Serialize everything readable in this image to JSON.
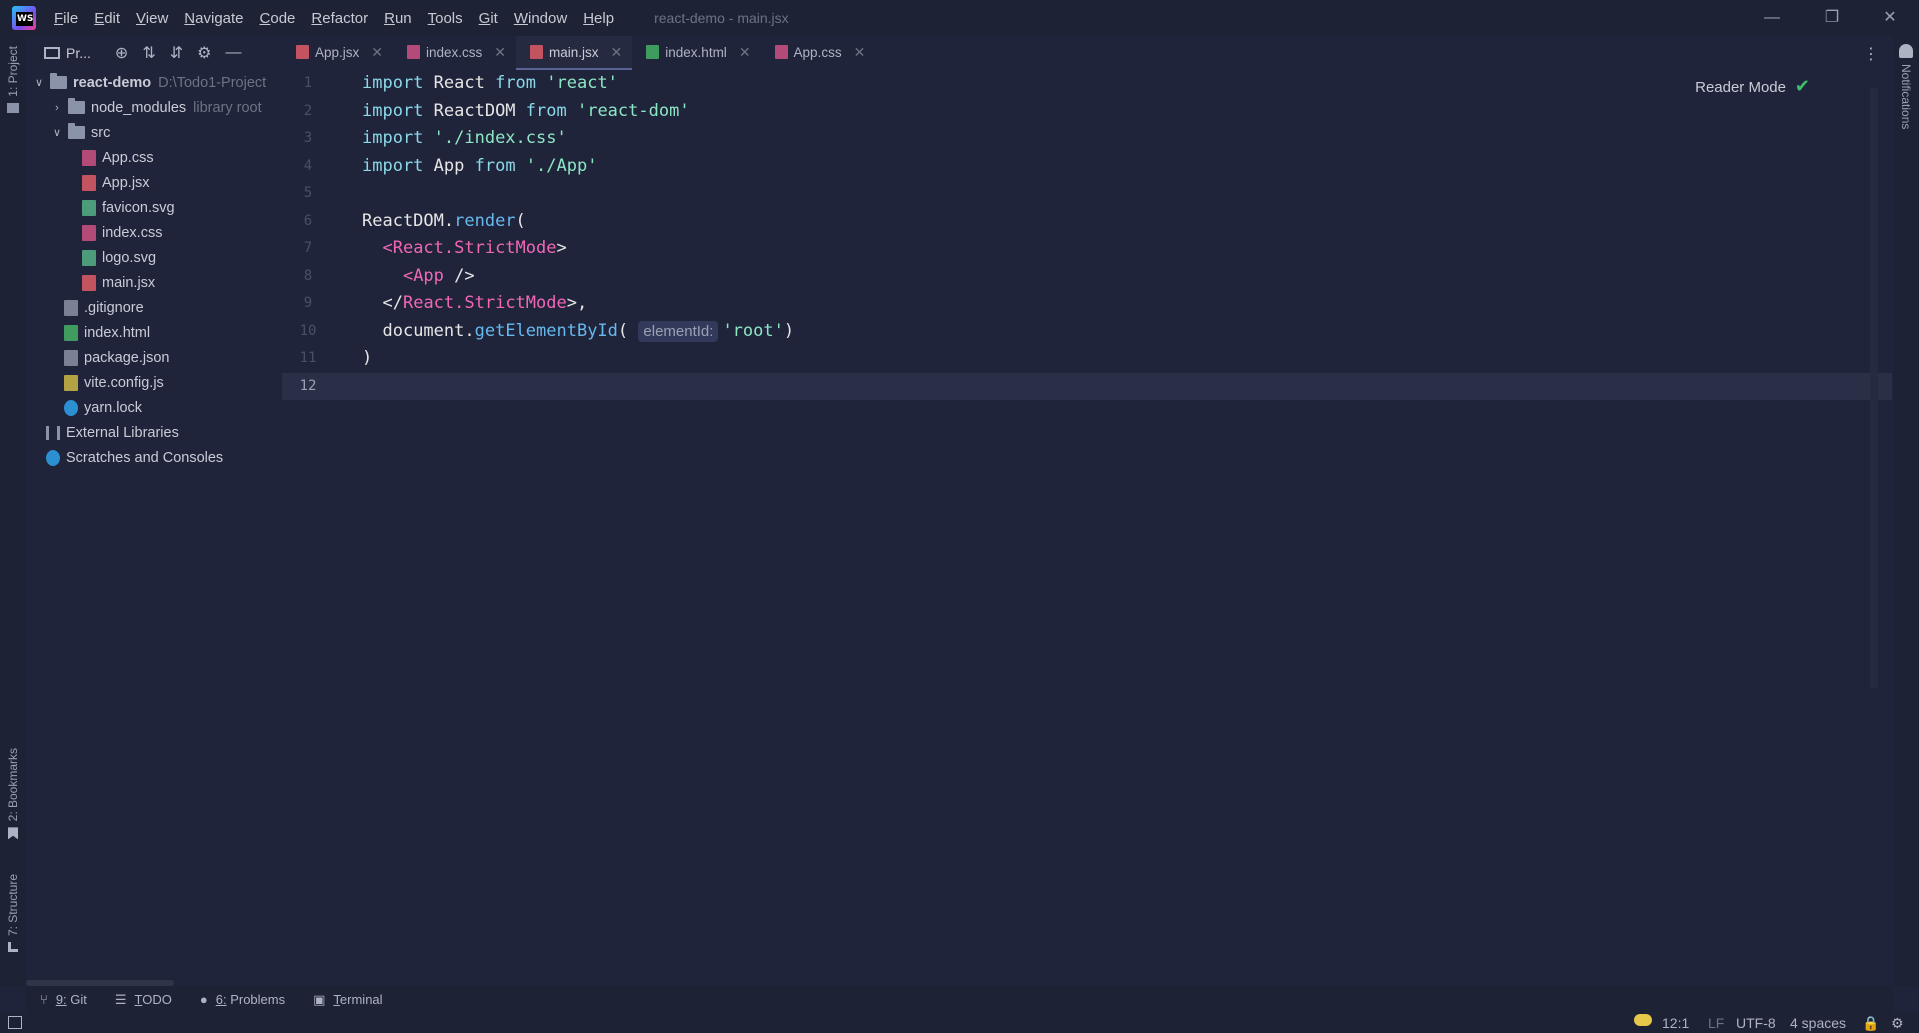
{
  "window": {
    "title": "react-demo - main.jsx",
    "menu": [
      "File",
      "Edit",
      "View",
      "Navigate",
      "Code",
      "Refactor",
      "Run",
      "Tools",
      "Git",
      "Window",
      "Help"
    ]
  },
  "left_strip": {
    "project_label": "1: Project",
    "bookmarks_label": "2: Bookmarks",
    "structure_label": "7: Structure"
  },
  "right_strip": {
    "notifications_label": "Notifications"
  },
  "project_panel": {
    "title": "Pr...",
    "tree": [
      {
        "label": "react-demo",
        "hint": "D:\\Todo1-Project",
        "type": "folder",
        "depth": 0,
        "open": true
      },
      {
        "label": "node_modules",
        "hint": "library root",
        "type": "folder",
        "depth": 1,
        "open": false
      },
      {
        "label": "src",
        "type": "folder",
        "depth": 1,
        "open": true
      },
      {
        "label": "App.css",
        "type": "css",
        "depth": 2
      },
      {
        "label": "App.jsx",
        "type": "jsx",
        "depth": 2
      },
      {
        "label": "favicon.svg",
        "type": "svg",
        "depth": 2
      },
      {
        "label": "index.css",
        "type": "css",
        "depth": 2
      },
      {
        "label": "logo.svg",
        "type": "svg",
        "depth": 2
      },
      {
        "label": "main.jsx",
        "type": "jsx",
        "depth": 2
      },
      {
        "label": ".gitignore",
        "type": "git",
        "depth": 1
      },
      {
        "label": "index.html",
        "type": "html",
        "depth": 1
      },
      {
        "label": "package.json",
        "type": "json",
        "depth": 1
      },
      {
        "label": "vite.config.js",
        "type": "js",
        "depth": 1
      },
      {
        "label": "yarn.lock",
        "type": "yarn",
        "depth": 1
      },
      {
        "label": "External Libraries",
        "type": "lib",
        "depth": 0
      },
      {
        "label": "Scratches and Consoles",
        "type": "scratch",
        "depth": 0
      }
    ]
  },
  "tabs": [
    {
      "label": "App.jsx",
      "type": "jsx",
      "active": false
    },
    {
      "label": "index.css",
      "type": "css",
      "active": false
    },
    {
      "label": "main.jsx",
      "type": "jsx",
      "active": true
    },
    {
      "label": "index.html",
      "type": "html",
      "active": false
    },
    {
      "label": "App.css",
      "type": "css",
      "active": false
    }
  ],
  "editor": {
    "reader_mode": "Reader Mode",
    "current_line": 12,
    "line_numbers": [
      "1",
      "2",
      "3",
      "4",
      "5",
      "6",
      "7",
      "8",
      "9",
      "10",
      "11",
      "12"
    ],
    "lines": [
      [
        [
          "kw",
          "import "
        ],
        [
          "plain",
          "React "
        ],
        [
          "kw",
          "from "
        ],
        [
          "str",
          "'react'"
        ]
      ],
      [
        [
          "kw",
          "import "
        ],
        [
          "plain",
          "ReactDOM "
        ],
        [
          "kw",
          "from "
        ],
        [
          "str",
          "'react-dom'"
        ]
      ],
      [
        [
          "kw",
          "import "
        ],
        [
          "str",
          "'./index.css'"
        ]
      ],
      [
        [
          "kw",
          "import "
        ],
        [
          "plain",
          "App "
        ],
        [
          "kw",
          "from "
        ],
        [
          "str",
          "'./App'"
        ]
      ],
      [],
      [
        [
          "plain",
          "ReactDOM."
        ],
        [
          "fn",
          "render"
        ],
        [
          "plain",
          "("
        ]
      ],
      [
        [
          "guide",
          "  "
        ],
        [
          "tag",
          "<React.StrictMode"
        ],
        [
          "plain",
          ">"
        ]
      ],
      [
        [
          "guide",
          "    "
        ],
        [
          "tag",
          "<App"
        ],
        [
          "plain",
          " />"
        ]
      ],
      [
        [
          "guide",
          "  "
        ],
        [
          "plain",
          "</"
        ],
        [
          "tag",
          "React.StrictMode"
        ],
        [
          "plain",
          ">,"
        ]
      ],
      [
        [
          "guide",
          "  "
        ],
        [
          "plain",
          "document."
        ],
        [
          "fn",
          "getElementById"
        ],
        [
          "plain",
          "( "
        ],
        [
          "hint",
          "elementId:"
        ],
        [
          "str",
          "'root'"
        ],
        [
          "plain",
          ")"
        ]
      ],
      [
        [
          "plain",
          ")"
        ]
      ],
      []
    ]
  },
  "bottom_tools": [
    {
      "icon": "git-branch-icon",
      "glyph": "⑂",
      "label": "9: Git"
    },
    {
      "icon": "todo-list-icon",
      "glyph": "☰",
      "label": "TODO"
    },
    {
      "icon": "problems-icon",
      "glyph": "●",
      "label": "6: Problems"
    },
    {
      "icon": "terminal-icon",
      "glyph": "▣",
      "label": "Terminal"
    }
  ],
  "status_bar": {
    "position": "12:1",
    "line_ending": "LF",
    "encoding": "UTF-8",
    "indent": "4 spaces"
  }
}
